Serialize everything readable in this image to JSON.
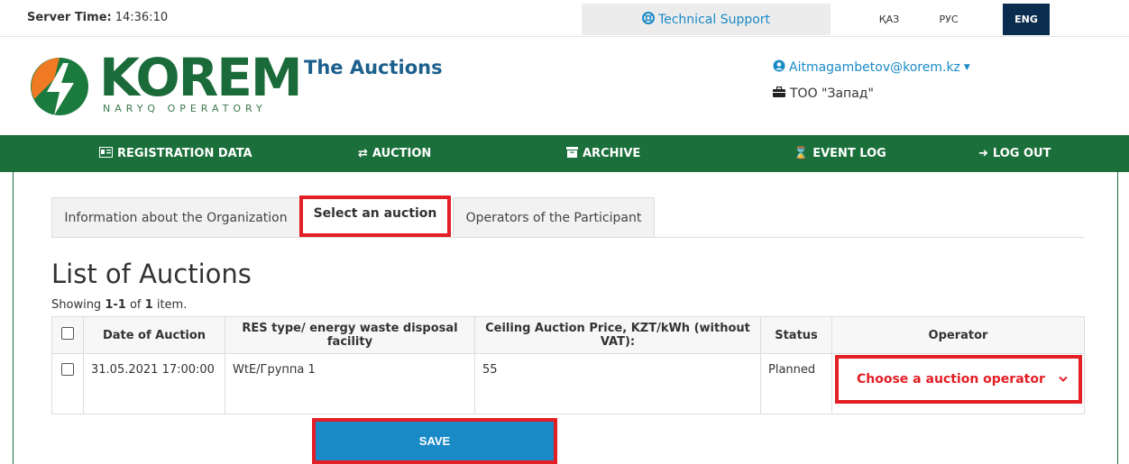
{
  "topbar": {
    "server_time_label": "Server Time:",
    "server_time_value": "14:36:10",
    "support_label": "Technical Support",
    "languages": [
      "ҚАЗ",
      "РУС",
      "ENG"
    ],
    "active_language": "ENG"
  },
  "header": {
    "logo_text": "KOREM",
    "logo_subtext": "NARYQ OPERATORY",
    "title": "The Auctions",
    "user_email": "Aitmagambetov@korem.kz",
    "user_org": "ТОО \"Запад\""
  },
  "nav": {
    "items": [
      {
        "label": "REGISTRATION DATA",
        "icon": "id-card-icon"
      },
      {
        "label": "AUCTION",
        "icon": "exchange-icon"
      },
      {
        "label": "ARCHIVE",
        "icon": "archive-icon"
      },
      {
        "label": "EVENT LOG",
        "icon": "hourglass-icon"
      },
      {
        "label": "LOG OUT",
        "icon": "logout-icon"
      }
    ]
  },
  "tabs": [
    {
      "label": "Information about the Organization"
    },
    {
      "label": "Select an auction",
      "active": true
    },
    {
      "label": "Operators of the Participant"
    }
  ],
  "list": {
    "title": "List of Auctions",
    "showing_prefix": "Showing",
    "showing_range": "1-1",
    "showing_of": "of",
    "showing_total": "1",
    "showing_suffix": "item.",
    "columns": [
      "Date of Auction",
      "RES type/ energy waste disposal facility",
      "Ceiling Auction Price, KZT/kWh (without VAT):",
      "Status",
      "Operator"
    ],
    "rows": [
      {
        "date": "31.05.2021 17:00:00",
        "res_type": "WtE/Группа 1",
        "ceiling_price": "55",
        "status": "Planned",
        "operator_select": "Choose a auction operator"
      }
    ]
  },
  "save_label": "SAVE",
  "colors": {
    "brand_green": "#1a6f3a",
    "accent_blue": "#1a8ac7",
    "highlight_red": "#e31e24",
    "lang_active_bg": "#0a2c4e"
  }
}
